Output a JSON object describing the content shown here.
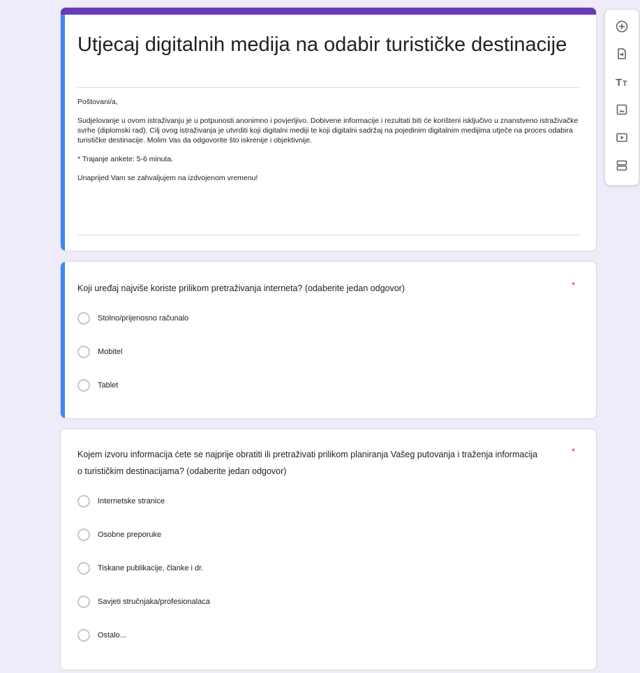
{
  "form": {
    "title": "Utjecaj digitalnih medija na odabir turističke destinacije",
    "description": {
      "greeting": "Poštovani/a,",
      "paragraph": "Sudjelovanje u ovom istraživanju je u potpunosti anonimno i povjerljivo. Dobivene informacije i rezultati biti će korišteni isključivo u znanstveno istraživačke svrhe (diplomski rad). Cilj ovog istraživanja je utvrditi koji digitalni mediji te koji digitalni sadržaj na pojedinim digitalnim medijima utječe na proces odabira turističke destinacije. Molim Vas da odgovorite što iskrenije i objektivnije.",
      "duration": "* Trajanje ankete: 5-6 minuta.",
      "thanks": "Unaprijed Vam se zahvaljujem na izdvojenom vremenu!"
    },
    "accent_color": "#673ab7",
    "selected_color": "#4285f4",
    "required_color": "#d93025"
  },
  "questions": [
    {
      "title": "Koji uređaj najviše koriste prilikom pretraživanja interneta? (odaberite jedan odgovor)",
      "required_mark": "*",
      "options": [
        "Stolno/prijenosno računalo",
        "Mobitel",
        "Tablet"
      ]
    },
    {
      "title": "Kojem izvoru informacija ćete se najprije obratiti ili pretraživati prilikom planiranja Vašeg putovanja i traženja informacija o turističkim destinacijama? (odaberite jedan odgovor)",
      "required_mark": "*",
      "options": [
        "Internetske stranice",
        "Osobne preporuke",
        "Tiskane publikacije, članke i dr.",
        "Savjeti stručnjaka/profesionalaca",
        "Ostalo..."
      ]
    }
  ],
  "toolbar": {
    "icons": [
      "add-question-icon",
      "import-questions-icon",
      "add-title-icon",
      "add-image-icon",
      "add-video-icon",
      "add-section-icon"
    ]
  }
}
